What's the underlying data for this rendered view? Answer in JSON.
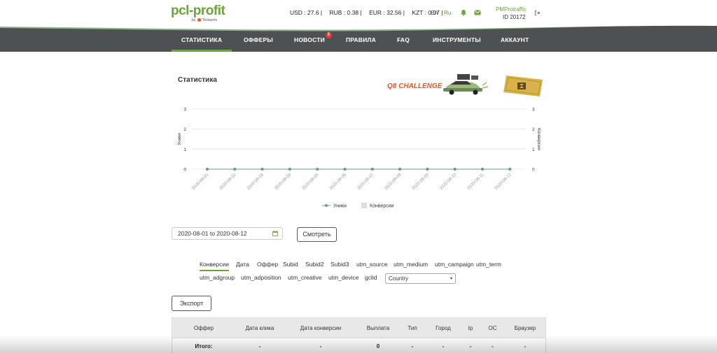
{
  "brand": {
    "logo_main": "pcl-profit",
    "logo_by": "by",
    "logo_company": "Textasms"
  },
  "header": {
    "rates": [
      "USD : 27.6 |",
      "RUB : 0.38 |",
      "EUR : 32.56 |",
      "KZT : 0.07 |"
    ],
    "lang_en": "En",
    "lang_ru": "Ru",
    "username": "PMProtraffic",
    "user_id": "ID 20172"
  },
  "nav": {
    "items": [
      {
        "label": "СТАТИСТИКА"
      },
      {
        "label": "ОФФЕРЫ"
      },
      {
        "label": "НОВОСТИ",
        "badge": "3"
      },
      {
        "label": "ПРАВИЛА"
      },
      {
        "label": "FAQ"
      },
      {
        "label": "ИНСТРУМЕНТЫ"
      },
      {
        "label": "АККАУНТ"
      }
    ]
  },
  "stats": {
    "title": "Статистика",
    "banner_text": "Q8 CHALLENGE"
  },
  "chart_data": {
    "type": "line",
    "x": [
      "2020-08-01",
      "2020-08-02",
      "2020-08-03",
      "2020-08-04",
      "2020-08-05",
      "2020-08-06",
      "2020-08-07",
      "2020-08-08",
      "2020-08-09",
      "2020-08-10",
      "2020-08-11",
      "2020-08-12"
    ],
    "series": [
      {
        "name": "Уники",
        "values": [
          0,
          0,
          0,
          0,
          0,
          0,
          0,
          0,
          0,
          0,
          0,
          0
        ],
        "color": "#6a9e8e"
      },
      {
        "name": "Конверсии",
        "values": [
          0,
          0,
          0,
          0,
          0,
          0,
          0,
          0,
          0,
          0,
          0,
          0
        ],
        "color": "#dddddd"
      }
    ],
    "ylabel": "Уники",
    "y2label": "Конверсии",
    "ylim": [
      0,
      3
    ],
    "yticks": [
      "0",
      "1",
      "2",
      "3"
    ],
    "grid": true,
    "legend": "bottom"
  },
  "filters": {
    "date_range": "2020-08-01 to 2020-08-12",
    "view_button": "Смотреть",
    "export_button": "Экспорт",
    "groups_row1": [
      "Конверсии",
      "Дата",
      "Оффер",
      "Subid",
      "Subid2",
      "Subid3",
      "utm_source",
      "utm_medium",
      "utm_campaign",
      "utm_term"
    ],
    "groups_row2": [
      "utm_adgroup",
      "utm_adposition",
      "utm_creative",
      "utm_device",
      "gclid"
    ],
    "country_select": "Country"
  },
  "table": {
    "headers": [
      "Оффер",
      "Дата клика",
      "Дата конверсии",
      "Выплата",
      "Тип",
      "Город",
      "Ip",
      "ОС",
      "Браузер"
    ],
    "total_row": [
      "Итого:",
      "-",
      "-",
      "0",
      "-",
      "-",
      "-",
      "-",
      "-"
    ]
  },
  "colors": {
    "accent": "#6aa43a",
    "nav_bg": "#4d5154",
    "badge": "#e53935"
  }
}
